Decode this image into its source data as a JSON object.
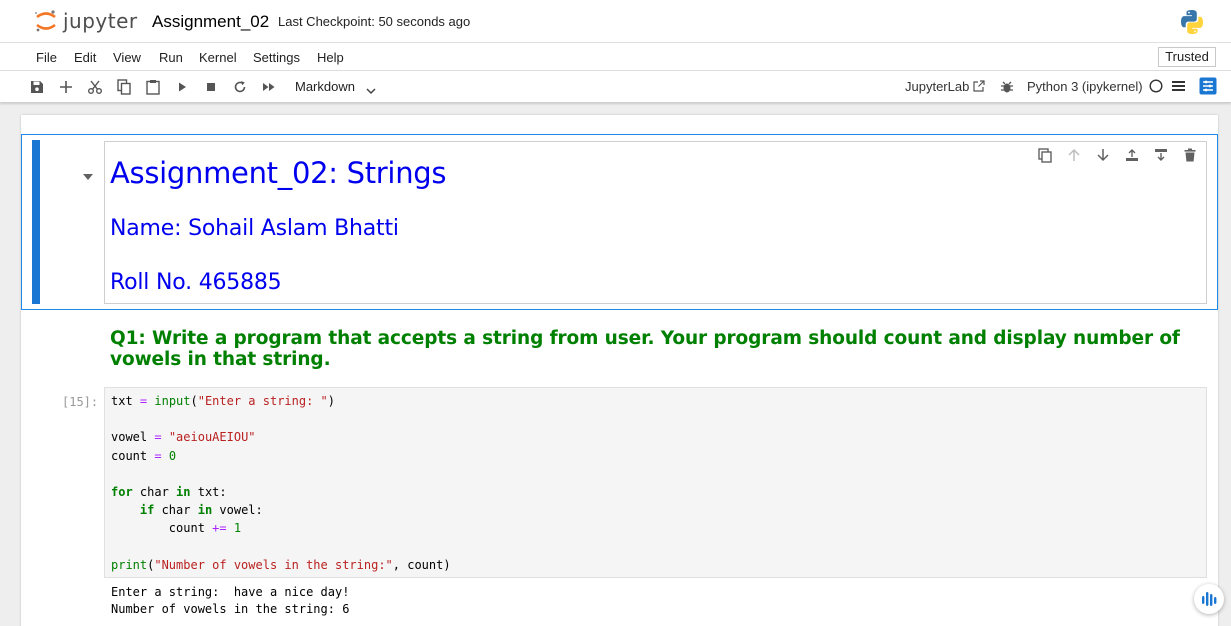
{
  "header": {
    "logo_text": "jupyter",
    "notebook_title": "Assignment_02",
    "checkpoint": "Last Checkpoint: 50 seconds ago"
  },
  "menu": [
    "File",
    "Edit",
    "View",
    "Run",
    "Kernel",
    "Settings",
    "Help"
  ],
  "trusted_label": "Trusted",
  "toolbar": {
    "cell_type": "Markdown",
    "jupyterlab_label": "JupyterLab",
    "kernel_name": "Python 3 (ipykernel)"
  },
  "markdown_cell": {
    "title": "Assignment_02: Strings",
    "name_line": "Name: Sohail Aslam Bhatti",
    "roll_line": "Roll No. 465885"
  },
  "question": "Q1: Write a program that accepts a string from user. Your program should count and display number of vowels in that string.",
  "code_cell": {
    "prompt": "[15]:",
    "lines": [
      "txt = input(\"Enter a string: \")",
      "",
      "vowel = \"aeiouAEIOU\"",
      "count = 0",
      "",
      "for char in txt:",
      "    if char in vowel:",
      "        count += 1",
      "",
      "print(\"Number of vowels in the string:\", count)"
    ],
    "output": [
      "Enter a string:  have a nice day!",
      "Number of vowels in the string: 6"
    ]
  },
  "colors": {
    "accent": "#1976d2",
    "heading_blue": "#0000ee",
    "question_green": "#008000",
    "jupyter_orange": "#f37726"
  }
}
